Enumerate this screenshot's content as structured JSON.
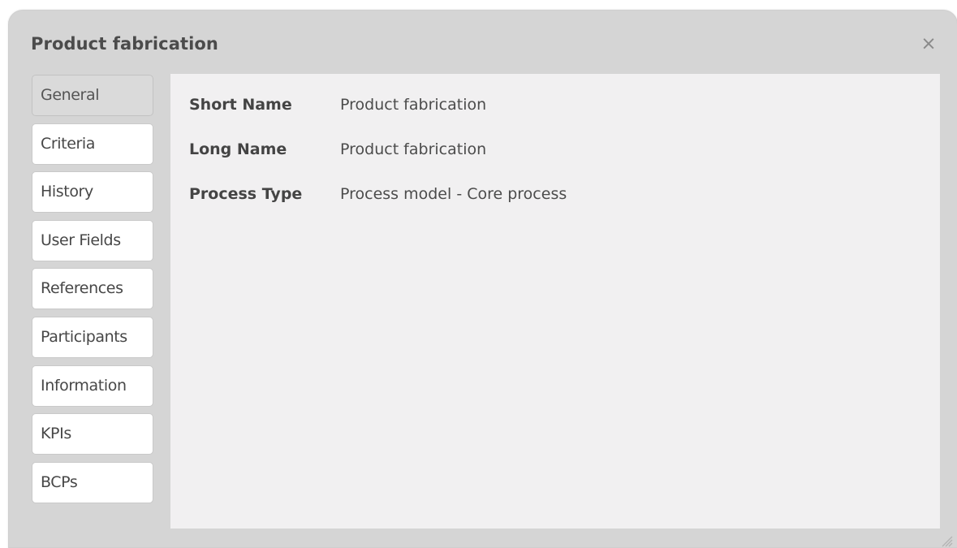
{
  "dialog": {
    "title": "Product fabrication",
    "close_symbol": "×"
  },
  "tabs": [
    {
      "label": "General",
      "active": true
    },
    {
      "label": "Criteria",
      "active": false
    },
    {
      "label": "History",
      "active": false
    },
    {
      "label": "User Fields",
      "active": false
    },
    {
      "label": "References",
      "active": false
    },
    {
      "label": "Participants",
      "active": false
    },
    {
      "label": "Information",
      "active": false
    },
    {
      "label": "KPIs",
      "active": false
    },
    {
      "label": "BCPs",
      "active": false
    }
  ],
  "general": {
    "fields": [
      {
        "label": "Short Name",
        "value": "Product fabrication"
      },
      {
        "label": "Long Name",
        "value": "Product fabrication"
      },
      {
        "label": "Process Type",
        "value": "Process model - Core process"
      }
    ]
  },
  "icons": {
    "close": "close-icon",
    "resize": "resize-grip-icon"
  }
}
